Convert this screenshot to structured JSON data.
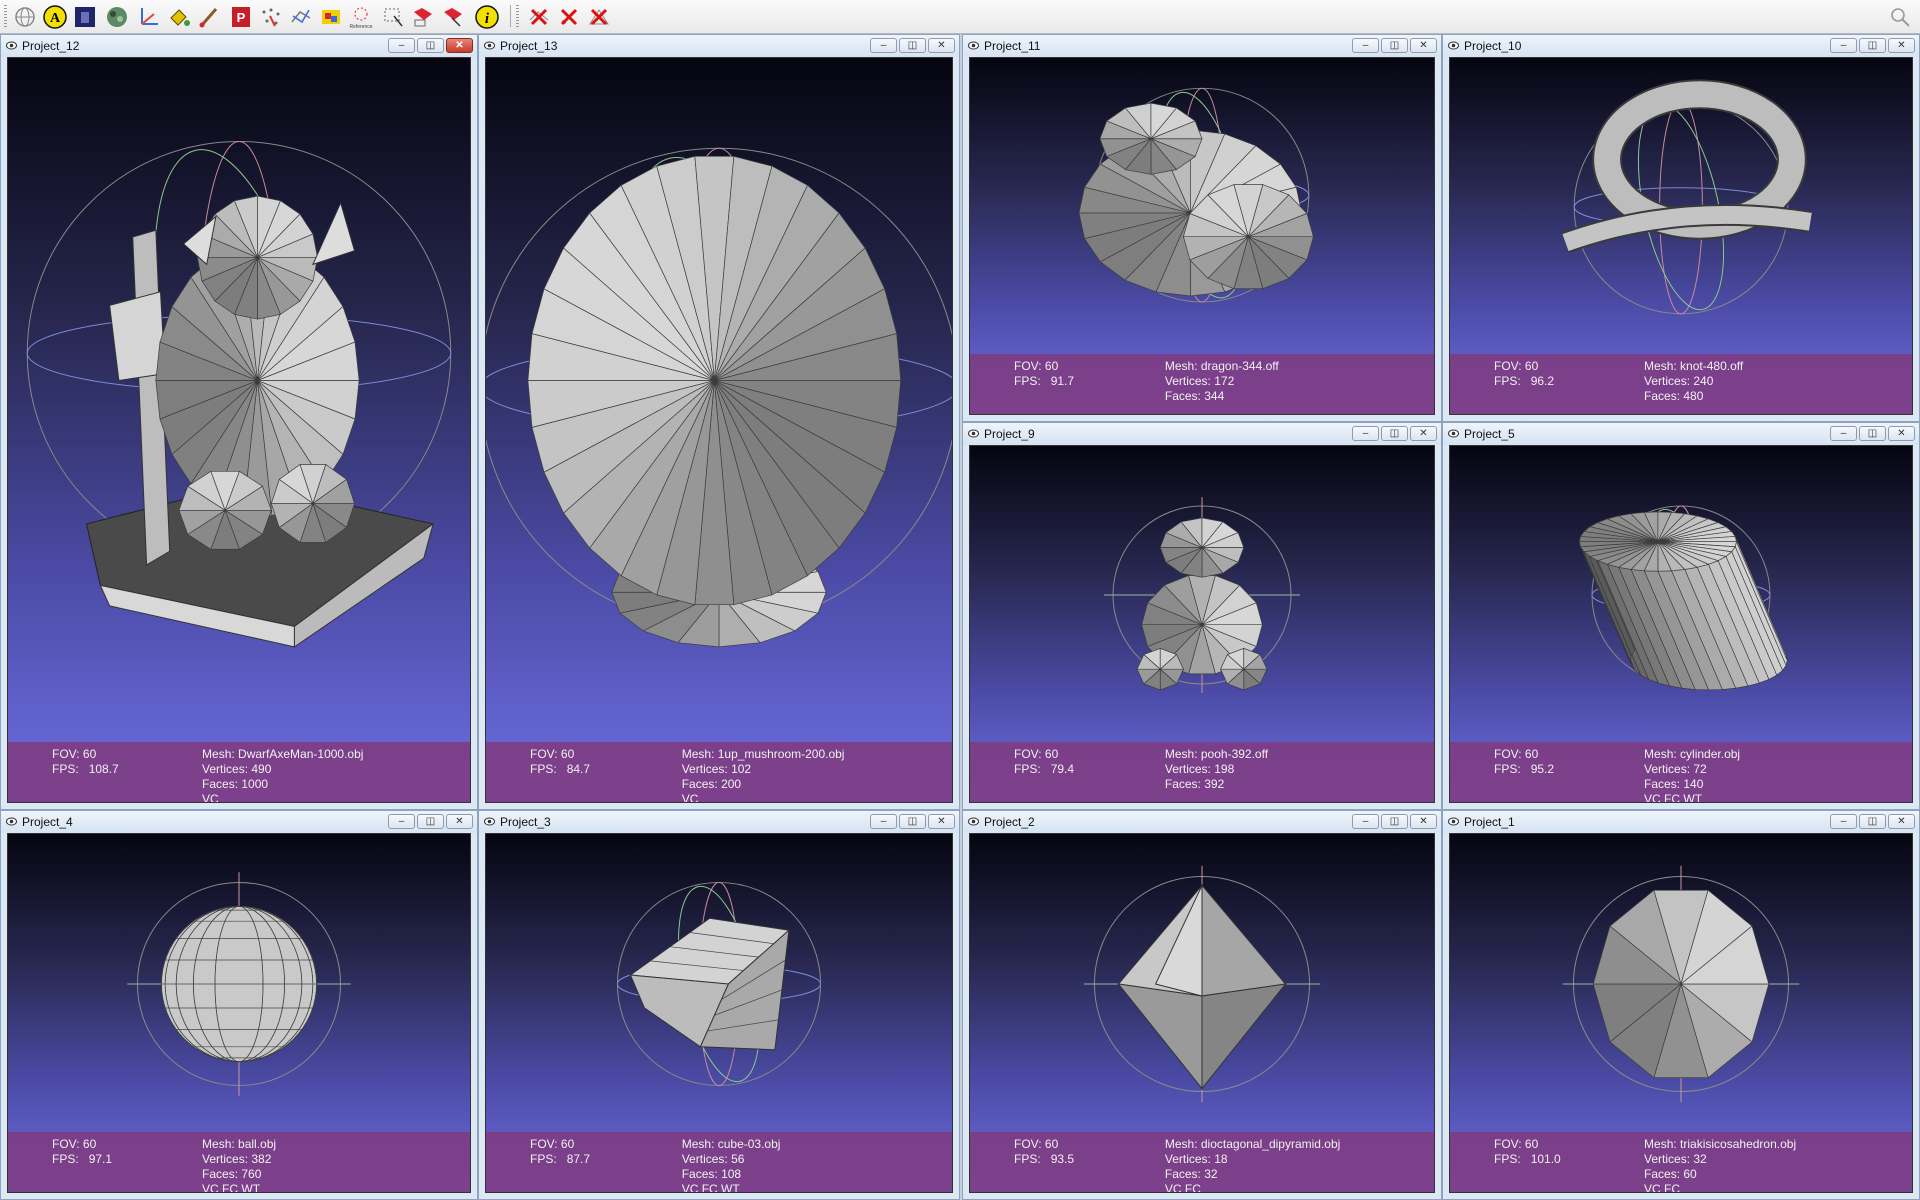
{
  "toolbar": {
    "icons": [
      "globe-icon",
      "annotate-a-icon",
      "layer-icon",
      "texture-icon",
      "axis-icon",
      "paint-bucket-icon",
      "brush-icon",
      "pdf-icon",
      "points-pick-icon",
      "align-icon",
      "measure-icon",
      "reference-icon",
      "select-points-icon",
      "select-faces-icon",
      "select-connected-icon",
      "info-icon",
      "delete-faces-icon",
      "delete-vertices-icon",
      "delete-all-icon"
    ],
    "reference_label": "Reference"
  },
  "windows": [
    {
      "id": "p12",
      "title": "Project_12",
      "fov": "FOV: 60",
      "fps_label": "FPS:",
      "fps": "108.7",
      "mesh": "Mesh: DwarfAxeMan-1000.obj",
      "vertices": "Vertices: 490",
      "faces": "Faces: 1000",
      "extra": "VC",
      "model": "dwarf",
      "active": true
    },
    {
      "id": "p13",
      "title": "Project_13",
      "fov": "FOV: 60",
      "fps_label": "FPS:",
      "fps": "84.7",
      "mesh": "Mesh: 1up_mushroom-200.obj",
      "vertices": "Vertices: 102",
      "faces": "Faces: 200",
      "extra": "VC",
      "model": "mushroom"
    },
    {
      "id": "p11",
      "title": "Project_11",
      "fov": "FOV: 60",
      "fps_label": "FPS:",
      "fps": "91.7",
      "mesh": "Mesh: dragon-344.off",
      "vertices": "Vertices: 172",
      "faces": "Faces: 344",
      "extra": "",
      "model": "dragon"
    },
    {
      "id": "p10",
      "title": "Project_10",
      "fov": "FOV: 60",
      "fps_label": "FPS:",
      "fps": "96.2",
      "mesh": "Mesh: knot-480.off",
      "vertices": "Vertices: 240",
      "faces": "Faces: 480",
      "extra": "",
      "model": "knot"
    },
    {
      "id": "p9",
      "title": "Project_9",
      "fov": "FOV: 60",
      "fps_label": "FPS:",
      "fps": "79.4",
      "mesh": "Mesh: pooh-392.off",
      "vertices": "Vertices: 198",
      "faces": "Faces: 392",
      "extra": "",
      "model": "pooh"
    },
    {
      "id": "p5",
      "title": "Project_5",
      "fov": "FOV: 60",
      "fps_label": "FPS:",
      "fps": "95.2",
      "mesh": "Mesh: cylinder.obj",
      "vertices": "Vertices: 72",
      "faces": "Faces: 140",
      "extra": "VC FC WT",
      "model": "cylinder"
    },
    {
      "id": "p4",
      "title": "Project_4",
      "fov": "FOV: 60",
      "fps_label": "FPS:",
      "fps": "97.1",
      "mesh": "Mesh: ball.obj",
      "vertices": "Vertices: 382",
      "faces": "Faces: 760",
      "extra": "VC FC WT",
      "model": "ball"
    },
    {
      "id": "p3",
      "title": "Project_3",
      "fov": "FOV: 60",
      "fps_label": "FPS:",
      "fps": "87.7",
      "mesh": "Mesh: cube-03.obj",
      "vertices": "Vertices: 56",
      "faces": "Faces: 108",
      "extra": "VC FC WT",
      "model": "cube"
    },
    {
      "id": "p2",
      "title": "Project_2",
      "fov": "FOV: 60",
      "fps_label": "FPS:",
      "fps": "93.5",
      "mesh": "Mesh: dioctagonal_dipyramid.obj",
      "vertices": "Vertices: 18",
      "faces": "Faces: 32",
      "extra": "VC FC",
      "model": "dipyramid"
    },
    {
      "id": "p1",
      "title": "Project_1",
      "fov": "FOV: 60",
      "fps_label": "FPS:",
      "fps": "101.0",
      "mesh": "Mesh: triakisicosahedron.obj",
      "vertices": "Vertices: 32",
      "faces": "Faces: 60",
      "extra": "VC FC",
      "model": "icosa"
    }
  ],
  "colors": {
    "info_bar": "#803a80",
    "viewport_top": "#050510",
    "viewport_bottom": "#6e6ee2",
    "mesh_fill": "#c8c8c8",
    "trackball": "#8a8a8a"
  }
}
